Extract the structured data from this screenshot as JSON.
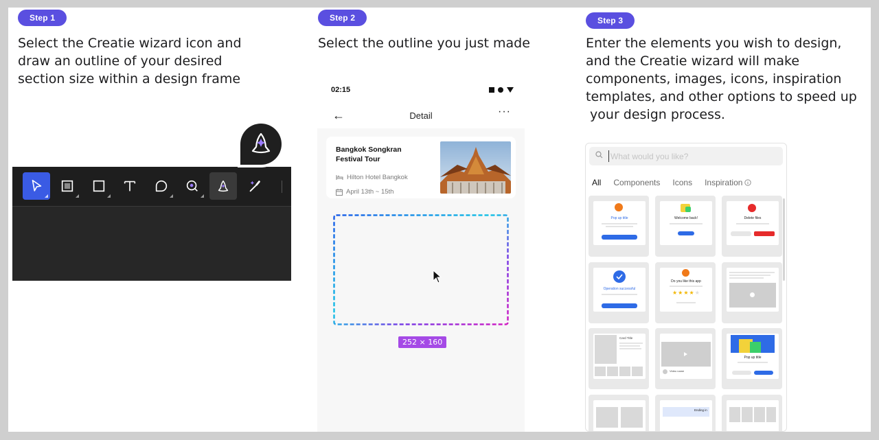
{
  "steps": [
    {
      "badge": "Step 1",
      "lines": [
        "Select the Creatie wizard icon and",
        "draw an outline of your desired",
        "section size within a design frame"
      ]
    },
    {
      "badge": "Step 2",
      "lines": [
        "Select the outline you just made"
      ]
    },
    {
      "badge": "Step 3",
      "lines": [
        "Enter the elements you wish to design,",
        "and the Creatie wizard will make",
        "components, images, icons, inspiration",
        "templates, and other options to speed up",
        " your design process."
      ]
    }
  ],
  "toolbar": {
    "tools": [
      {
        "icon": "pointer-icon",
        "active": true
      },
      {
        "icon": "frame-icon"
      },
      {
        "icon": "rectangle-icon"
      },
      {
        "icon": "text-icon"
      },
      {
        "icon": "comment-icon"
      },
      {
        "icon": "zoom-icon"
      },
      {
        "icon": "wizard-hat-icon",
        "hover": true
      },
      {
        "icon": "magic-brush-icon"
      }
    ]
  },
  "phone": {
    "time": "02:15",
    "nav_title": "Detail",
    "back_glyph": "←",
    "more_glyph": "⋮",
    "card": {
      "title": "Bangkok Songkran Festival Tour",
      "hotel": "Hilton Hotel Bangkok",
      "dates": "April 13th ~ 15th"
    },
    "selection_size": "252 × 160"
  },
  "wizard": {
    "search_placeholder": "What would you like?",
    "tabs": [
      "All",
      "Components",
      "Icons",
      "Inspiration"
    ],
    "active_tab": "All",
    "templates": {
      "popup_title": "Pop up title",
      "welcome": "Welcome back!",
      "delete": "Delete files",
      "operation": "Operation successful",
      "like_app": "Do you like this app",
      "card_title": "Card Title",
      "video_name": "Video name",
      "ending": "Ending in"
    }
  },
  "colors": {
    "accent": "#5a4fe0",
    "toolbar_active": "#3a5be4",
    "size_label": "#a54ae6",
    "button_blue": "#2e6be6",
    "warning_red": "#e62b2b",
    "star_gold": "#f2b705"
  }
}
